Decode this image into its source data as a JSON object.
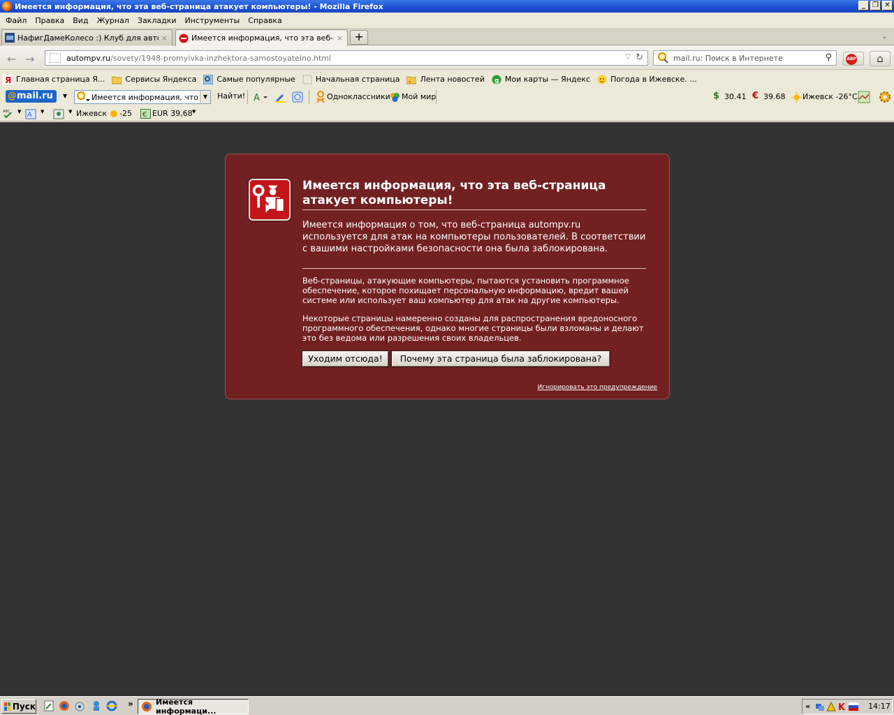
{
  "window": {
    "title": "Имеется информация, что эта веб-страница атакует компьютеры! - Mozilla Firefox",
    "btn_min": "_",
    "btn_max": "❐",
    "btn_close": "✕"
  },
  "menu": [
    "Файл",
    "Правка",
    "Вид",
    "Журнал",
    "Закладки",
    "Инструменты",
    "Справка"
  ],
  "tabs": [
    {
      "label": "НафигДамеКолесо :) Клуб для автоле...",
      "close": "×"
    },
    {
      "label": "Имеется информация, что эта веб-стр...",
      "close": "×"
    }
  ],
  "new_tab": "+",
  "tab_list": "⌄",
  "nav": {
    "back": "←",
    "forward": "→",
    "url_domain": "autompv.ru",
    "url_path": "/sovety/1948-promyivka-inzhektora-samostoyatelno.html",
    "dropdown": "▽",
    "reload": "↻",
    "search_placeholder": "mail.ru: Поиск в Интернете",
    "search_button": "⚲",
    "abp": "ABP",
    "home": "⌂"
  },
  "bookmarks": [
    "Главная страница Я...",
    "Сервисы Яндекса",
    "Самые популярные",
    "Начальная страница",
    "Лента новостей",
    "Мои карты — Яндекс",
    "Погода в Ижевске. ..."
  ],
  "mailru": {
    "logo_at": "@",
    "logo": "mail.ru",
    "search_value": "Имеется информация, что эт",
    "find": "Найти!",
    "odnoklassniki": "Одноклассники",
    "moimir": "Мой мир",
    "usd": "30.41",
    "eur": "39.68",
    "weather": "Ижевск -26°C",
    "dollar_sign": "$",
    "euro_sign": "€"
  },
  "smallbar": {
    "city": "Ижевск",
    "temp": "-25",
    "eur": "EUR 39,68"
  },
  "error": {
    "title": "Имеется информация, что эта веб-страница атакует компьютеры!",
    "lead": "Имеется информация о том, что веб-страница autompv.ru используется для атак на компьютеры пользователей. В соответствии с вашими настройками безопасности она была заблокирована.",
    "p1": "Веб-страницы, атакующие компьютеры, пытаются установить программное обеспечение, которое похищает персональную информацию, вредит вашей системе или использует ваш компьютер для атак на другие компьютеры.",
    "p2": "Некоторые страницы намеренно созданы для распространения вредоносного программного обеспечения, однако многие страницы были взломаны и делают это без ведома или разрешения своих владельцев.",
    "btn_leave": "Уходим отсюда!",
    "btn_why": "Почему эта страница была заблокирована?",
    "ignore": "Игнорировать это предупреждение"
  },
  "taskbar": {
    "start": "Пуск",
    "chevron": "»",
    "task": "Имеется информаци...",
    "tray_chevron": "«",
    "time": "14:17"
  }
}
